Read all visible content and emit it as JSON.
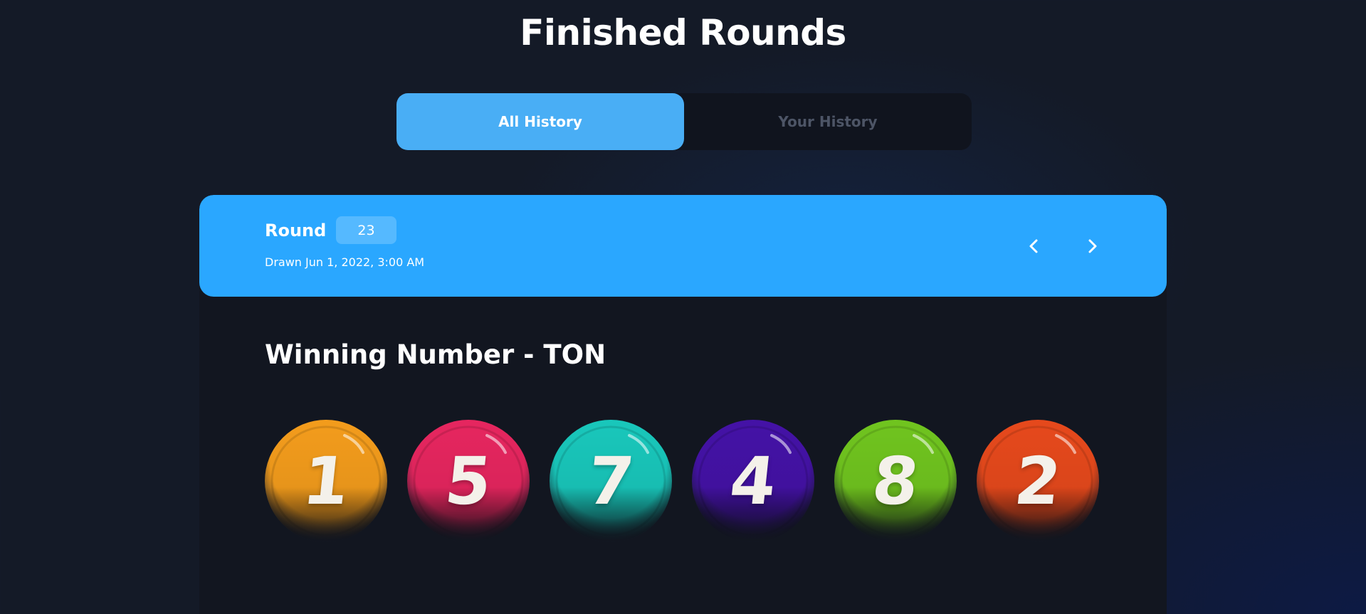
{
  "page": {
    "title": "Finished Rounds"
  },
  "tabs": [
    {
      "label": "All History",
      "active": true
    },
    {
      "label": "Your History",
      "active": false
    }
  ],
  "round": {
    "label": "Round",
    "number": "23",
    "drawn": "Drawn Jun 1, 2022, 3:00 AM",
    "prev_icon": "chevron-left-icon",
    "next_icon": "chevron-right-icon"
  },
  "winning": {
    "title": "Winning Number - TON",
    "balls": [
      {
        "number": "1",
        "color": "#f39c1c"
      },
      {
        "number": "5",
        "color": "#e6265f"
      },
      {
        "number": "7",
        "color": "#19c7bb"
      },
      {
        "number": "4",
        "color": "#4412a6"
      },
      {
        "number": "8",
        "color": "#70c41f"
      },
      {
        "number": "2",
        "color": "#e6491c"
      }
    ]
  },
  "colors": {
    "accent": "#2aa7ff",
    "tab_active": "#49aef5",
    "background": "#141a27",
    "card": "#121620"
  }
}
